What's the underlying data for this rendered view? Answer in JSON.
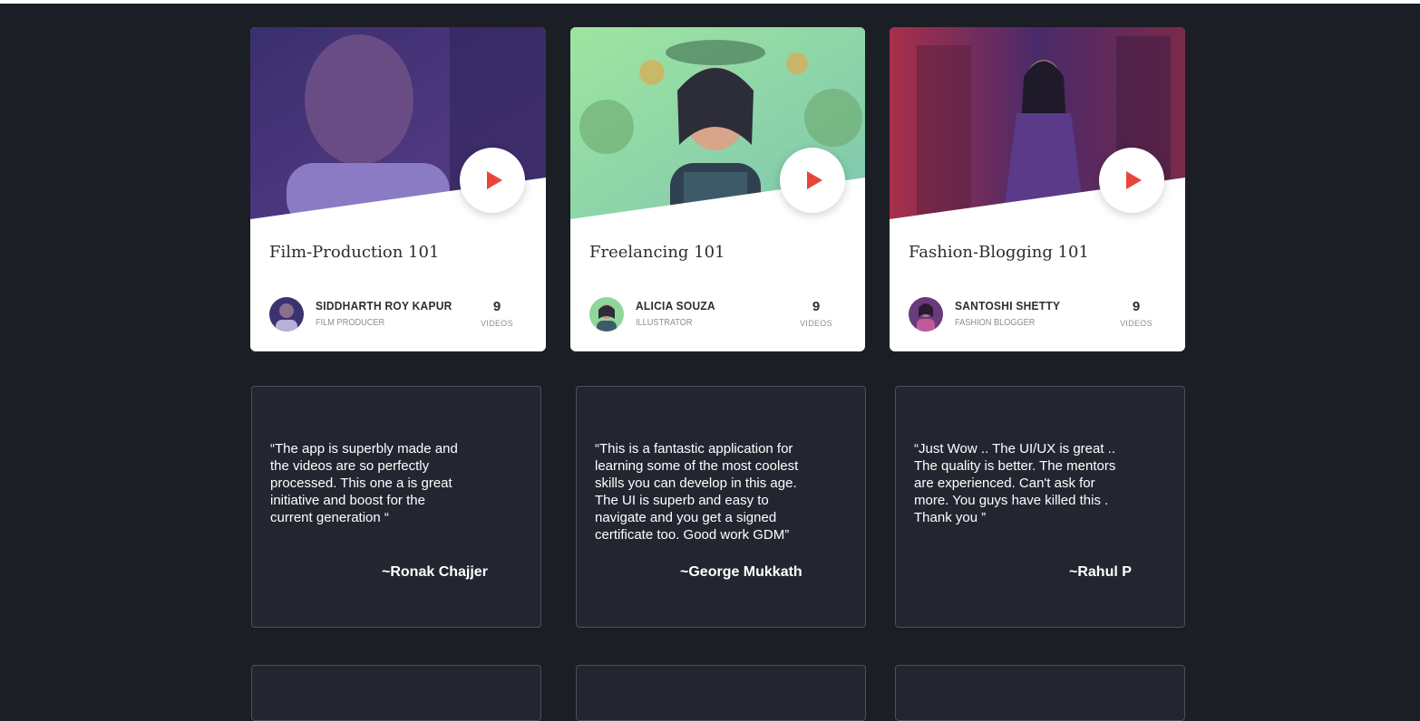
{
  "colors": {
    "background": "#1b1e25",
    "card": "#ffffff",
    "testimonial_bg": "#232630",
    "testimonial_border": "#4c505a",
    "play_accent": "#e8463a"
  },
  "courses": [
    {
      "title": "Film-Production 101",
      "mentor_name": "SIDDHARTH ROY KAPUR",
      "mentor_role": "FILM PRODUCER",
      "video_count": "9",
      "video_label": "VIDEOS",
      "play_icon": "play-icon"
    },
    {
      "title": "Freelancing 101",
      "mentor_name": "ALICIA SOUZA",
      "mentor_role": "ILLUSTRATOR",
      "video_count": "9",
      "video_label": "VIDEOS",
      "play_icon": "play-icon"
    },
    {
      "title": "Fashion-Blogging 101",
      "mentor_name": "SANTOSHI SHETTY",
      "mentor_role": "FASHION BLOGGER",
      "video_count": "9",
      "video_label": "VIDEOS",
      "play_icon": "play-icon"
    }
  ],
  "testimonials": [
    {
      "quote": "“The app is superbly made and\n  the videos are so perfectly\n  processed. This one a is great\n  initiative and boost for the\n  current generation “",
      "author": "~Ronak Chajjer"
    },
    {
      "quote": "“This is a fantastic application for\n learning some of the most coolest\n skills you can develop in this age.\n The UI is superb and  easy to\n navigate and you get a signed\n certificate too. Good work GDM”",
      "author": "~George Mukkath"
    },
    {
      "quote": "“Just Wow .. The UI/UX is great ..\n The quality is better. The mentors\n are experienced. Can't ask for\n more. You guys have killed this .\n Thank you ”",
      "author": "~Rahul P"
    }
  ]
}
